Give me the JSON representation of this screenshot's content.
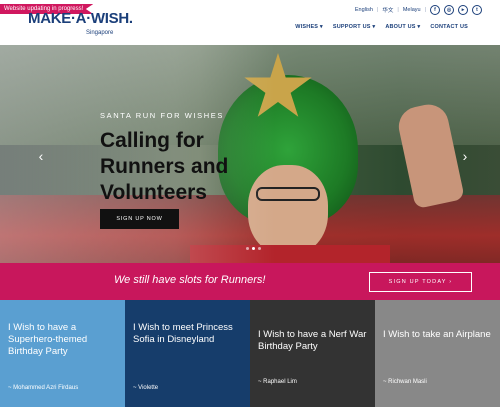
{
  "header": {
    "ribbon": "Website updating in progress!",
    "logo_text": "MAKE·A·WISH.",
    "logo_sub": "Singapore",
    "languages": [
      "English",
      "华文",
      "Melayu"
    ],
    "social_icons": [
      "facebook-icon",
      "instagram-icon",
      "youtube-icon",
      "twitter-icon"
    ],
    "nav": [
      "WISHES ▾",
      "SUPPORT US ▾",
      "ABOUT US ▾",
      "CONTACT US"
    ]
  },
  "hero": {
    "eyebrow": "SANTA RUN FOR WISHES",
    "headline": "Calling for Runners and Volunteers",
    "button": "SIGN UP NOW",
    "prev": "‹",
    "next": "›"
  },
  "banner": {
    "text": "We still have slots for Runners!",
    "button": "SIGN UP TODAY  ›"
  },
  "tiles": [
    {
      "title": "I Wish to have a Superhero-themed Birthday Party",
      "name": "~ Mohammed Azri Firdaus",
      "color": "#5a9fd1"
    },
    {
      "title": "I Wish to meet Princess Sofia in Disneyland",
      "name": "~ Violette",
      "color": "#163d6b"
    },
    {
      "title": "I Wish to have a Nerf War Birthday Party",
      "name": "~ Raphael Lim",
      "color": "#333333"
    },
    {
      "title": "I Wish to take an Airplane",
      "name": "~ Richwan Masli",
      "color": "#888888"
    }
  ]
}
